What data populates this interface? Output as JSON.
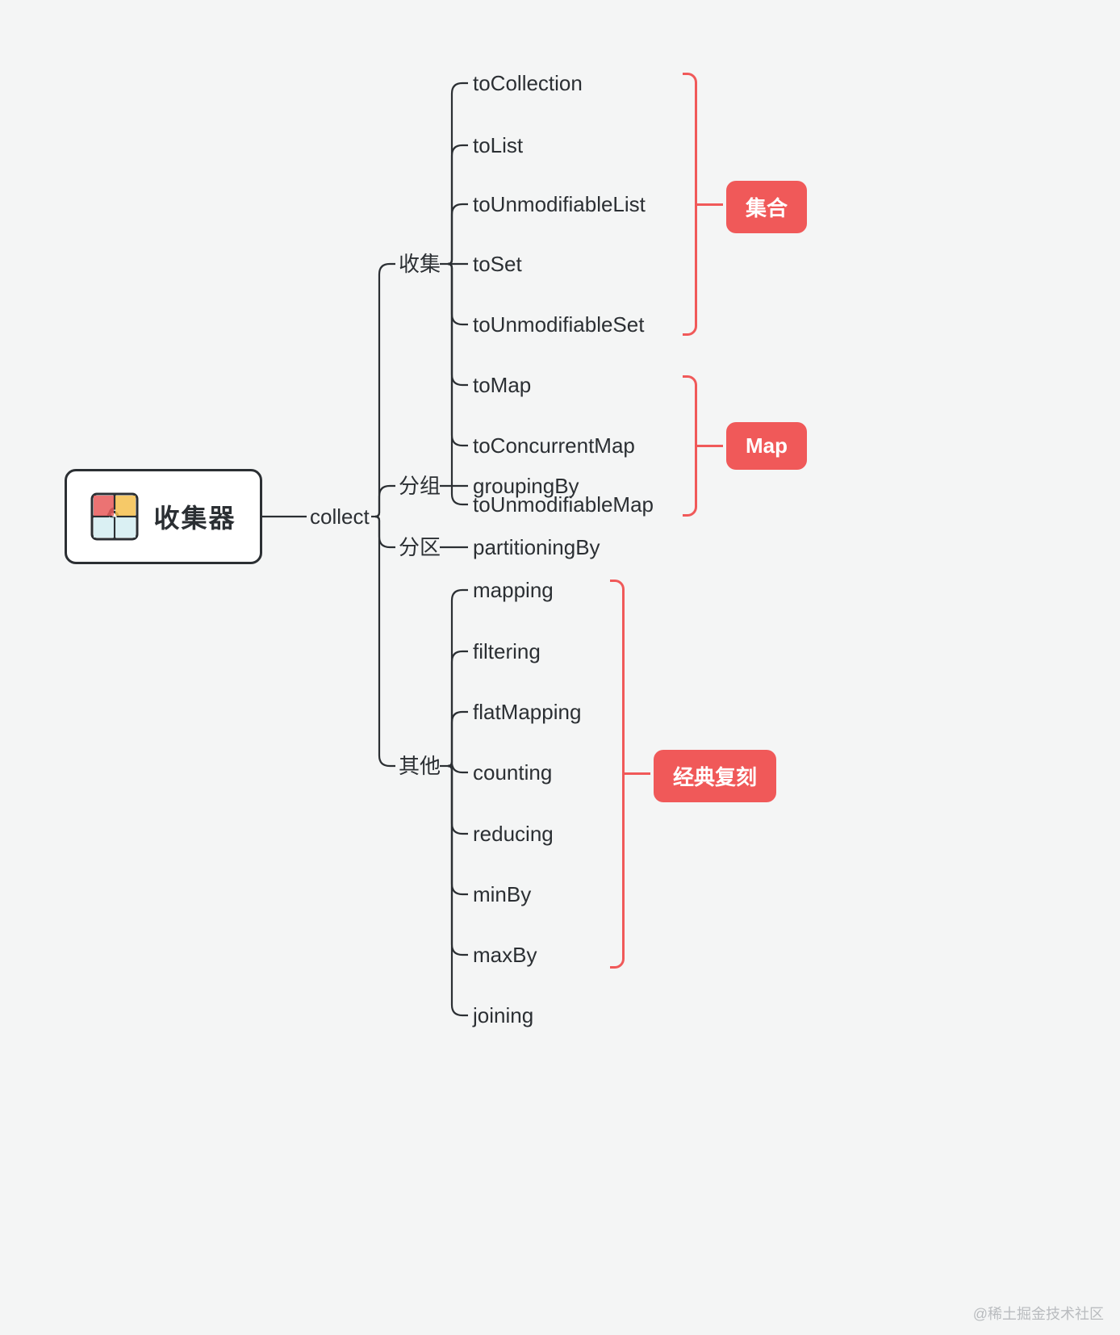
{
  "root": {
    "title": "收集器"
  },
  "collect": "collect",
  "branches": {
    "collect_label": "收集",
    "group_label": "分组",
    "partition_label": "分区",
    "other_label": "其他"
  },
  "leaves": {
    "toCollection": "toCollection",
    "toList": "toList",
    "toUnmodifiableList": "toUnmodifiableList",
    "toSet": "toSet",
    "toUnmodifiableSet": "toUnmodifiableSet",
    "toMap": "toMap",
    "toConcurrentMap": "toConcurrentMap",
    "toUnmodifiableMap": "toUnmodifiableMap",
    "groupingBy": "groupingBy",
    "partitioningBy": "partitioningBy",
    "mapping": "mapping",
    "filtering": "filtering",
    "flatMapping": "flatMapping",
    "counting": "counting",
    "reducing": "reducing",
    "minBy": "minBy",
    "maxBy": "maxBy",
    "joining": "joining"
  },
  "badges": {
    "set": "集合",
    "map": "Map",
    "classic": "经典复刻"
  },
  "watermark": "@稀土掘金技术社区"
}
